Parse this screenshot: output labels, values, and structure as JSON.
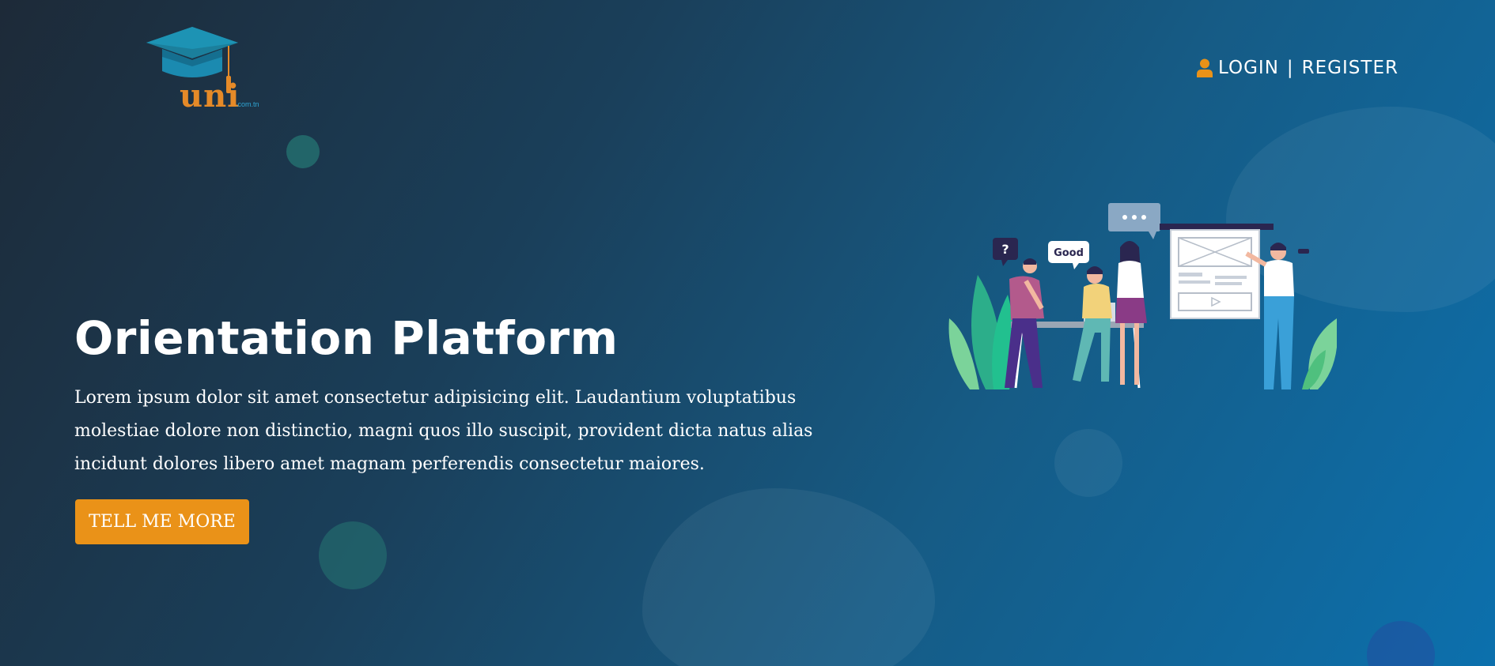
{
  "brand": {
    "logo_text": "uni",
    "logo_subtext": ".com.tn",
    "icon": "graduation-cap-icon"
  },
  "nav": {
    "login_label": "LOGIN",
    "separator": "|",
    "register_label": "REGISTER",
    "user_icon": "user-icon"
  },
  "hero": {
    "title": "Orientation Platform",
    "description": "Lorem ipsum dolor sit amet consectetur adipisicing elit. Laudantium voluptatibus molestiae dolore non distinctio, magni quos illo suscipit, provident dicta natus alias incidunt dolores libero amet magnam perferendis consectetur maiores.",
    "cta_label": "TELL ME MORE",
    "illustration_bubbles": {
      "question": "?",
      "good": "Good"
    }
  },
  "colors": {
    "accent": "#ea9218",
    "bg_dark": "#1d2a38",
    "bg_light": "#0c70ad",
    "logo_cap": "#1b8ab0",
    "logo_text": "#e58a28"
  }
}
